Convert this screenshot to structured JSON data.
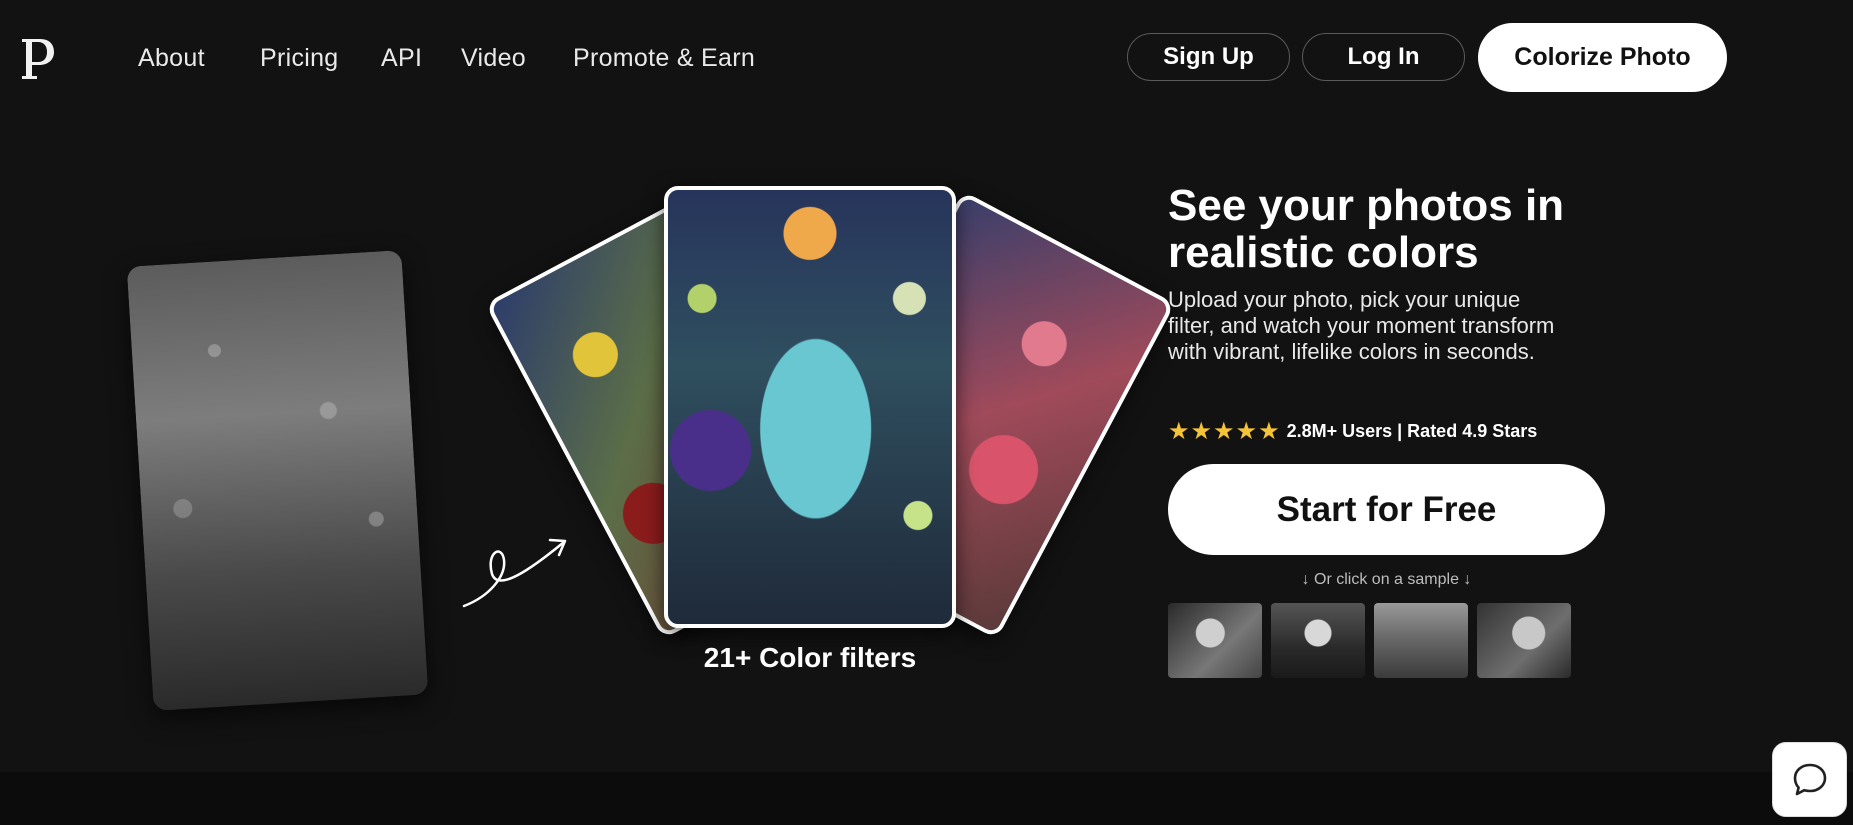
{
  "brand": {
    "logo_letter": "P"
  },
  "nav": {
    "links": [
      "About",
      "Pricing",
      "API",
      "Video",
      "Promote & Earn"
    ],
    "signup_label": "Sign Up",
    "login_label": "Log In",
    "colorize_label": "Colorize Photo"
  },
  "showcase": {
    "caption": "21+ Color filters"
  },
  "hero": {
    "title": "See your photos in realistic colors",
    "description": "Upload your photo, pick your unique filter, and watch your moment transform with vibrant, lifelike colors in seconds.",
    "stars": "★★★★★",
    "rating_text": "2.8M+ Users | Rated 4.9 Stars",
    "rating_value": 5,
    "cta_label": "Start for Free",
    "sample_hint": "↓ Or click on a sample ↓"
  },
  "colors": {
    "background": "#131212",
    "stars": "#f5c338",
    "button_bg": "#ffffff"
  },
  "icons": {
    "chat": "chat-bubble-icon",
    "arrow": "curly-arrow-icon"
  }
}
